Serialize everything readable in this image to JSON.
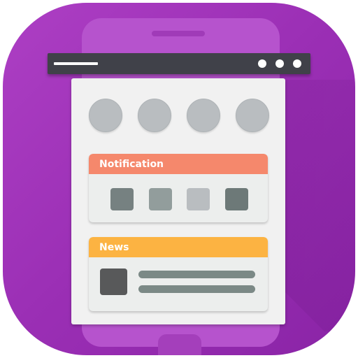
{
  "panels": {
    "notification": {
      "title": "Notification",
      "header_color": "#f5886c",
      "tiles": [
        {
          "name": "tile-1",
          "color": "#768181"
        },
        {
          "name": "tile-2",
          "color": "#929d9c"
        },
        {
          "name": "tile-3",
          "color": "#b9bdc0"
        },
        {
          "name": "tile-4",
          "color": "#6d7978"
        }
      ]
    },
    "news": {
      "title": "News",
      "header_color": "#fcb342"
    }
  },
  "colors": {
    "tile_background": "#9b2fb5",
    "window_bar": "#404149",
    "card": "#f1f1f1",
    "avatar": "#b9bdc0",
    "news_thumbnail": "#58595a",
    "news_text_line": "#7b8986"
  },
  "icons": {
    "window_controls": [
      "window-dot-icon",
      "window-dot-icon",
      "window-dot-icon"
    ],
    "avatars": [
      "avatar-circle",
      "avatar-circle",
      "avatar-circle",
      "avatar-circle"
    ]
  }
}
